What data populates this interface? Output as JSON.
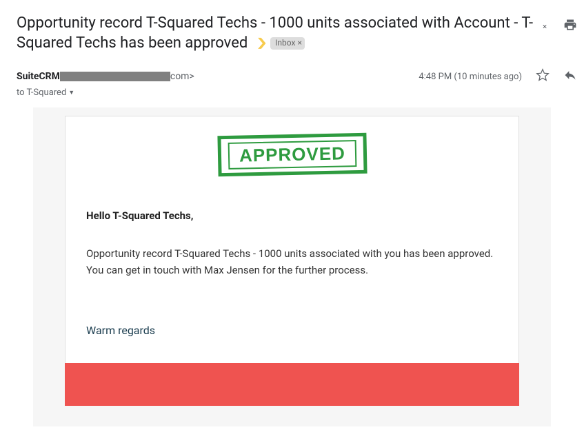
{
  "email": {
    "subject": "Opportunity record T-Squared Techs - 1000 units associated with Account - T-Squared Techs has been approved",
    "inbox_label": "Inbox",
    "sender_name": "SuiteCRM",
    "sender_domain_suffix": "com>",
    "recipient_prefix": "to",
    "recipient": "T-Squared",
    "timestamp": "4:48 PM (10 minutes ago)"
  },
  "body": {
    "stamp": "APPROVED",
    "greeting": "Hello T-Squared Techs,",
    "text": "Opportunity record T-Squared Techs - 1000 units associated with you has been approved. You can get in touch with Max Jensen for the further process.",
    "signoff": "Warm regards"
  }
}
